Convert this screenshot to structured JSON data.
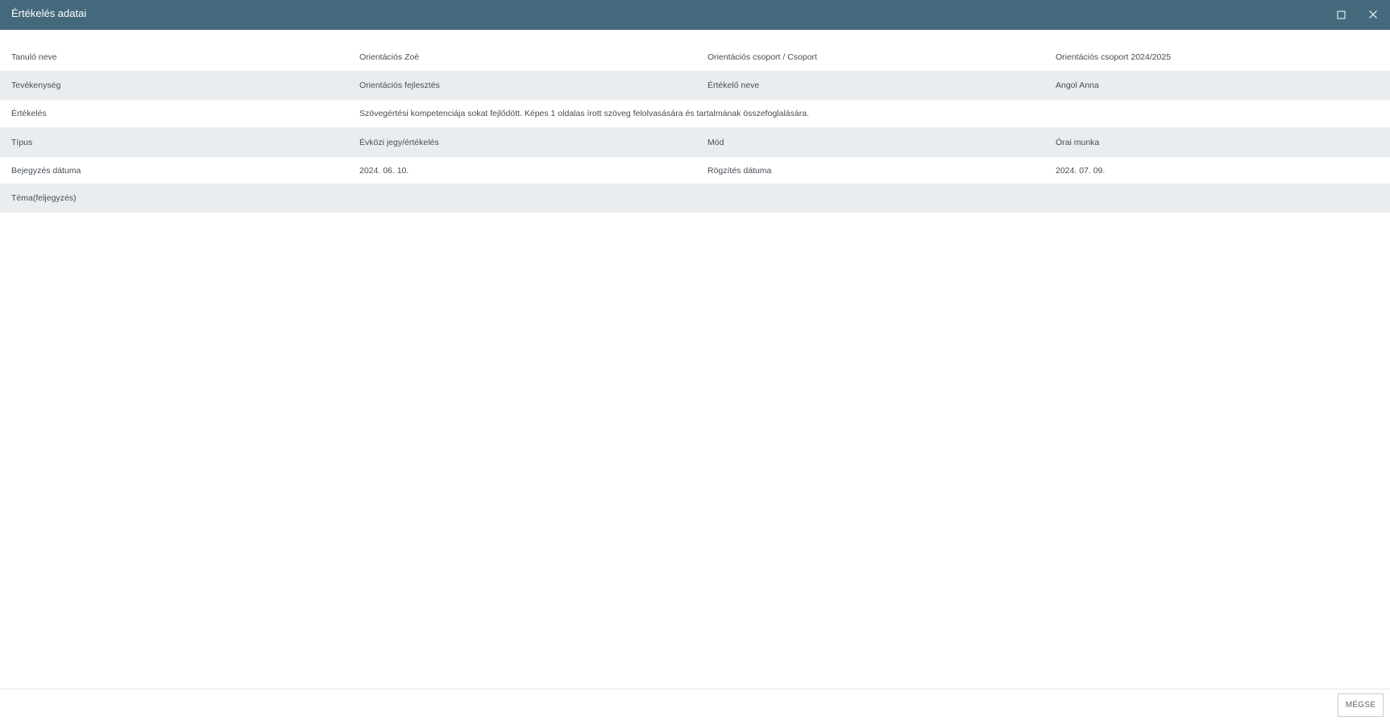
{
  "window": {
    "title": "Értékelés adatai",
    "maximize_icon": "maximize-icon",
    "close_icon": "close-icon",
    "header_color": "#44697c"
  },
  "details": {
    "rows": [
      {
        "label1": "Tanuló neve",
        "value1": "Orientációs Zoé",
        "label2": "Orientációs csoport / Csoport",
        "value2": "Orientációs csoport 2024/2025"
      },
      {
        "label1": "Tevékenység",
        "value1": "Orientációs fejlesztés",
        "label2": "Értékelő neve",
        "value2": "Angol Anna"
      },
      {
        "label1": "Értékelés",
        "value1": "Szövegértési kompetenciája sokat fejlődött. Képes 1 oldalas írott szöveg felolvasására és tartalmának összefoglalására."
      },
      {
        "label1": "Típus",
        "value1": "Évközi jegy/értékelés",
        "label2": "Mód",
        "value2": "Órai munka"
      },
      {
        "label1": "Bejegyzés dátuma",
        "value1": "2024. 06. 10.",
        "label2": "Rögzítés dátuma",
        "value2": "2024. 07. 09."
      },
      {
        "label1": "Téma(feljegyzés)"
      }
    ]
  },
  "footer": {
    "cancel_label": "MÉGSE"
  }
}
